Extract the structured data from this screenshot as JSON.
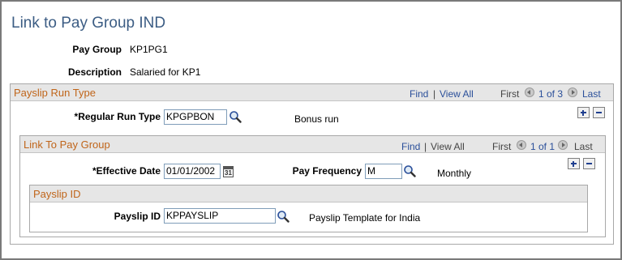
{
  "page": {
    "title": "Link to Pay Group IND"
  },
  "pay_group": {
    "label": "Pay Group",
    "value": "KP1PG1"
  },
  "description": {
    "label": "Description",
    "value": "Salaried for KP1"
  },
  "payslip_run_type": {
    "title": "Payslip Run Type",
    "find": "Find",
    "sep": "|",
    "view_all": "View All",
    "first": "First",
    "count": "1 of 3",
    "last": "Last",
    "field_label": "*Regular Run Type",
    "field_value": "KPGPBON",
    "field_desc": "Bonus run"
  },
  "link_to_pay_group": {
    "title": "Link To Pay Group",
    "find": "Find",
    "sep": "|",
    "view_all": "View All",
    "first": "First",
    "count": "1 of 1",
    "last": "Last",
    "effective_date_label": "*Effective Date",
    "effective_date_value": "01/01/2002",
    "pay_frequency_label": "Pay Frequency",
    "pay_frequency_value": "M",
    "pay_frequency_desc": "Monthly"
  },
  "payslip_id": {
    "title": "Payslip ID",
    "field_label": "Payslip ID",
    "field_value": "KPPAYSLIP",
    "field_desc": "Payslip Template for India"
  },
  "icons": {
    "lookup": "magnifier-icon",
    "calendar": "calendar-icon",
    "add": "plus-icon",
    "delete": "minus-icon",
    "prev": "arrow-left-icon",
    "next": "arrow-right-icon"
  },
  "colors": {
    "title": "#3c5d84",
    "section_title": "#c0651a",
    "link": "#2a4f9a",
    "header_bg": "#e6e6e6"
  }
}
